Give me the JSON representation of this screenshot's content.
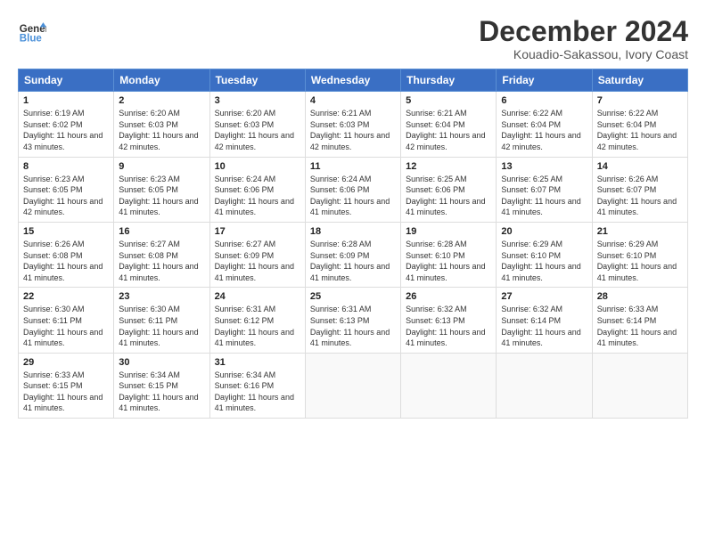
{
  "header": {
    "logo_line1": "General",
    "logo_line2": "Blue",
    "title": "December 2024",
    "subtitle": "Kouadio-Sakassou, Ivory Coast"
  },
  "days_of_week": [
    "Sunday",
    "Monday",
    "Tuesday",
    "Wednesday",
    "Thursday",
    "Friday",
    "Saturday"
  ],
  "weeks": [
    [
      {
        "day": 1,
        "sunrise": "6:19 AM",
        "sunset": "6:02 PM",
        "daylight": "11 hours and 43 minutes."
      },
      {
        "day": 2,
        "sunrise": "6:20 AM",
        "sunset": "6:03 PM",
        "daylight": "11 hours and 42 minutes."
      },
      {
        "day": 3,
        "sunrise": "6:20 AM",
        "sunset": "6:03 PM",
        "daylight": "11 hours and 42 minutes."
      },
      {
        "day": 4,
        "sunrise": "6:21 AM",
        "sunset": "6:03 PM",
        "daylight": "11 hours and 42 minutes."
      },
      {
        "day": 5,
        "sunrise": "6:21 AM",
        "sunset": "6:04 PM",
        "daylight": "11 hours and 42 minutes."
      },
      {
        "day": 6,
        "sunrise": "6:22 AM",
        "sunset": "6:04 PM",
        "daylight": "11 hours and 42 minutes."
      },
      {
        "day": 7,
        "sunrise": "6:22 AM",
        "sunset": "6:04 PM",
        "daylight": "11 hours and 42 minutes."
      }
    ],
    [
      {
        "day": 8,
        "sunrise": "6:23 AM",
        "sunset": "6:05 PM",
        "daylight": "11 hours and 42 minutes."
      },
      {
        "day": 9,
        "sunrise": "6:23 AM",
        "sunset": "6:05 PM",
        "daylight": "11 hours and 41 minutes."
      },
      {
        "day": 10,
        "sunrise": "6:24 AM",
        "sunset": "6:06 PM",
        "daylight": "11 hours and 41 minutes."
      },
      {
        "day": 11,
        "sunrise": "6:24 AM",
        "sunset": "6:06 PM",
        "daylight": "11 hours and 41 minutes."
      },
      {
        "day": 12,
        "sunrise": "6:25 AM",
        "sunset": "6:06 PM",
        "daylight": "11 hours and 41 minutes."
      },
      {
        "day": 13,
        "sunrise": "6:25 AM",
        "sunset": "6:07 PM",
        "daylight": "11 hours and 41 minutes."
      },
      {
        "day": 14,
        "sunrise": "6:26 AM",
        "sunset": "6:07 PM",
        "daylight": "11 hours and 41 minutes."
      }
    ],
    [
      {
        "day": 15,
        "sunrise": "6:26 AM",
        "sunset": "6:08 PM",
        "daylight": "11 hours and 41 minutes."
      },
      {
        "day": 16,
        "sunrise": "6:27 AM",
        "sunset": "6:08 PM",
        "daylight": "11 hours and 41 minutes."
      },
      {
        "day": 17,
        "sunrise": "6:27 AM",
        "sunset": "6:09 PM",
        "daylight": "11 hours and 41 minutes."
      },
      {
        "day": 18,
        "sunrise": "6:28 AM",
        "sunset": "6:09 PM",
        "daylight": "11 hours and 41 minutes."
      },
      {
        "day": 19,
        "sunrise": "6:28 AM",
        "sunset": "6:10 PM",
        "daylight": "11 hours and 41 minutes."
      },
      {
        "day": 20,
        "sunrise": "6:29 AM",
        "sunset": "6:10 PM",
        "daylight": "11 hours and 41 minutes."
      },
      {
        "day": 21,
        "sunrise": "6:29 AM",
        "sunset": "6:10 PM",
        "daylight": "11 hours and 41 minutes."
      }
    ],
    [
      {
        "day": 22,
        "sunrise": "6:30 AM",
        "sunset": "6:11 PM",
        "daylight": "11 hours and 41 minutes."
      },
      {
        "day": 23,
        "sunrise": "6:30 AM",
        "sunset": "6:11 PM",
        "daylight": "11 hours and 41 minutes."
      },
      {
        "day": 24,
        "sunrise": "6:31 AM",
        "sunset": "6:12 PM",
        "daylight": "11 hours and 41 minutes."
      },
      {
        "day": 25,
        "sunrise": "6:31 AM",
        "sunset": "6:13 PM",
        "daylight": "11 hours and 41 minutes."
      },
      {
        "day": 26,
        "sunrise": "6:32 AM",
        "sunset": "6:13 PM",
        "daylight": "11 hours and 41 minutes."
      },
      {
        "day": 27,
        "sunrise": "6:32 AM",
        "sunset": "6:14 PM",
        "daylight": "11 hours and 41 minutes."
      },
      {
        "day": 28,
        "sunrise": "6:33 AM",
        "sunset": "6:14 PM",
        "daylight": "11 hours and 41 minutes."
      }
    ],
    [
      {
        "day": 29,
        "sunrise": "6:33 AM",
        "sunset": "6:15 PM",
        "daylight": "11 hours and 41 minutes."
      },
      {
        "day": 30,
        "sunrise": "6:34 AM",
        "sunset": "6:15 PM",
        "daylight": "11 hours and 41 minutes."
      },
      {
        "day": 31,
        "sunrise": "6:34 AM",
        "sunset": "6:16 PM",
        "daylight": "11 hours and 41 minutes."
      },
      null,
      null,
      null,
      null
    ]
  ]
}
